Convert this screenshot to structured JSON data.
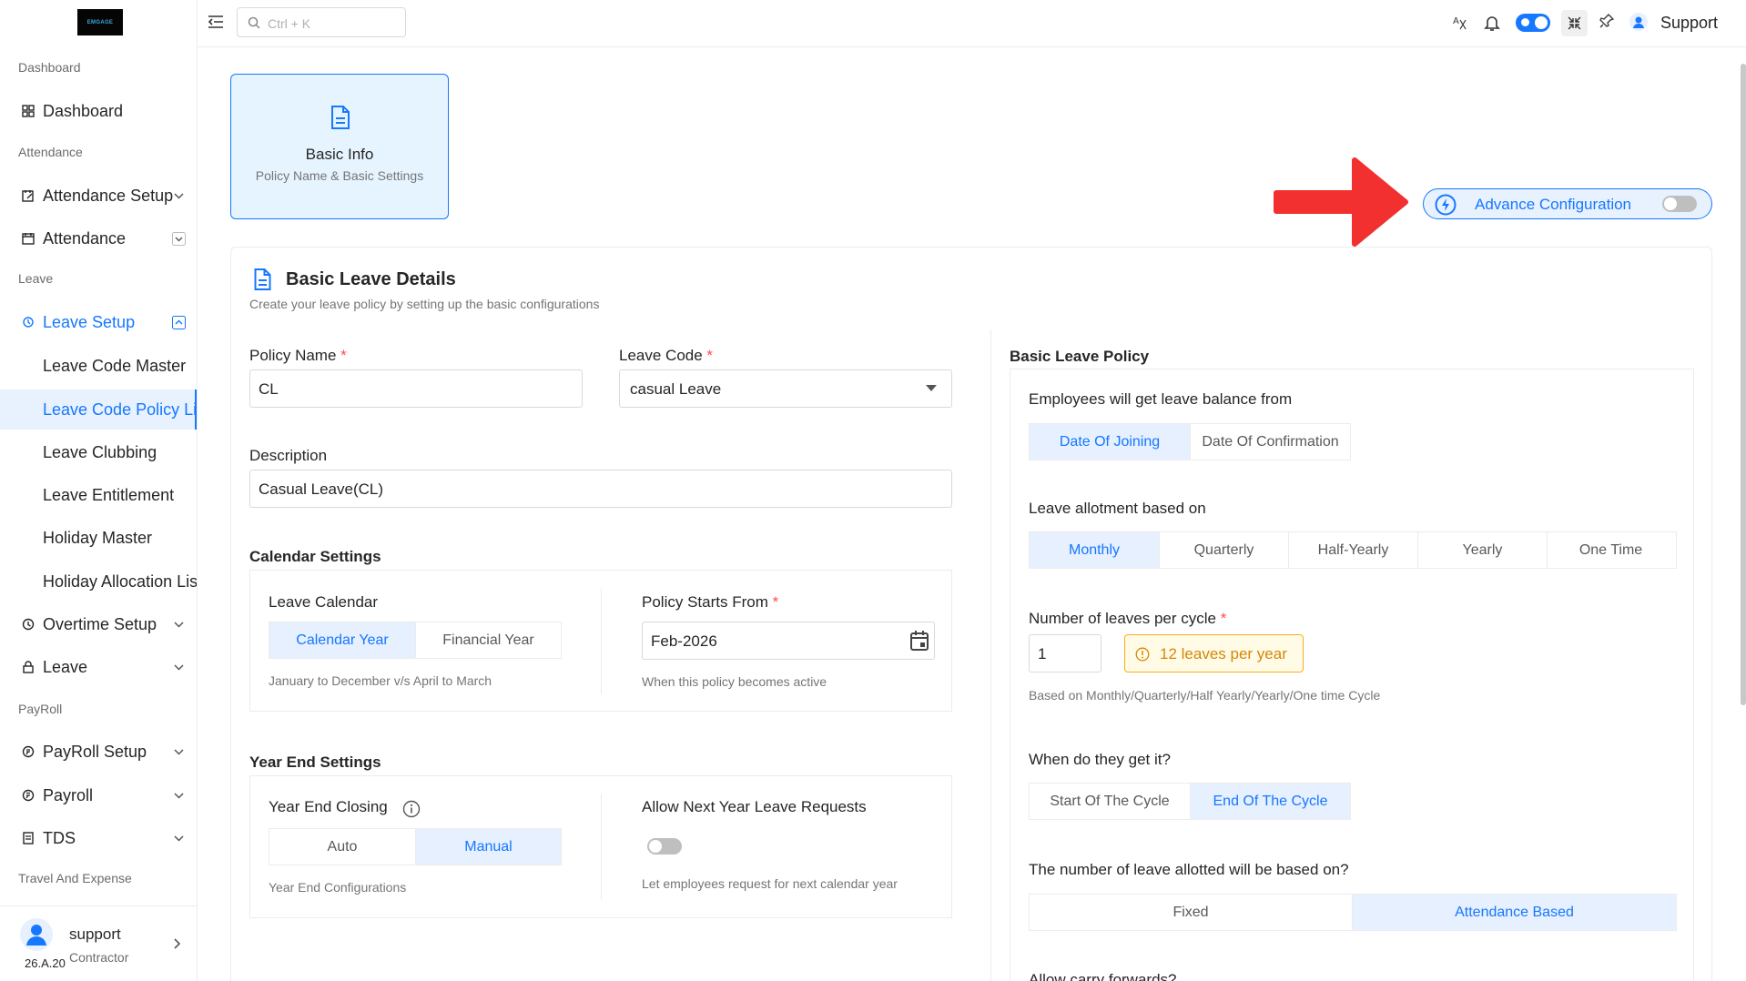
{
  "brand": {
    "logo_text": "EMGAGE"
  },
  "sidebar": {
    "sections": {
      "dashboard": "Dashboard",
      "attendance": "Attendance",
      "leave": "Leave",
      "payroll": "PayRoll",
      "travel": "Travel And Expense"
    },
    "items": {
      "dashboard": "Dashboard",
      "attendance_setup": "Attendance Setup",
      "attendance": "Attendance",
      "leave_setup": "Leave Setup",
      "leave_code_master": "Leave Code Master",
      "leave_code_policy": "Leave Code Policy List",
      "leave_clubbing": "Leave Clubbing",
      "leave_entitlement": "Leave Entitlement",
      "holiday_master": "Holiday Master",
      "holiday_allocation": "Holiday Allocation List",
      "overtime_setup": "Overtime Setup",
      "leave": "Leave",
      "payroll_setup": "PayRoll Setup",
      "payroll": "Payroll",
      "tds": "TDS"
    },
    "footer": {
      "user": "support",
      "role": "Contractor",
      "version": "26.A.20"
    }
  },
  "topbar": {
    "search_placeholder": "Ctrl + K",
    "user": "Support"
  },
  "step": {
    "title": "Basic Info",
    "subtitle": "Policy Name & Basic Settings"
  },
  "advance": {
    "label": "Advance Configuration",
    "enabled": false
  },
  "form": {
    "title": "Basic Leave Details",
    "subtitle": "Create your leave policy by setting up the basic configurations",
    "policy_name_label": "Policy Name",
    "policy_name_value": "CL",
    "leave_code_label": "Leave Code",
    "leave_code_value": "casual Leave",
    "description_label": "Description",
    "description_value": "Casual Leave(CL)",
    "required_mark": "*",
    "calendar": {
      "title": "Calendar Settings",
      "leave_calendar_label": "Leave Calendar",
      "options": [
        "Calendar Year",
        "Financial Year"
      ],
      "selected": "Calendar Year",
      "hint": "January to December v/s April to March",
      "starts_label": "Policy Starts From",
      "starts_value": "Feb-2026",
      "starts_hint": "When this policy becomes active"
    },
    "year_end": {
      "title": "Year End Settings",
      "closing_label": "Year End Closing",
      "options": [
        "Auto",
        "Manual"
      ],
      "selected": "Manual",
      "hint": "Year End Configurations",
      "allow_label": "Allow Next Year Leave Requests",
      "allow_enabled": false,
      "allow_hint": "Let employees request for next calendar year"
    },
    "policy": {
      "title": "Basic Leave Policy",
      "balance_label": "Employees will get leave balance from",
      "balance_options": [
        "Date Of Joining",
        "Date Of Confirmation"
      ],
      "balance_selected": "Date Of Joining",
      "allotment_label": "Leave allotment based on",
      "allotment_options": [
        "Monthly",
        "Quarterly",
        "Half-Yearly",
        "Yearly",
        "One Time"
      ],
      "allotment_selected": "Monthly",
      "per_cycle_label": "Number of leaves per cycle",
      "per_cycle_value": "1",
      "per_year_badge": "12 leaves per year",
      "per_cycle_hint": "Based on Monthly/Quarterly/Half Yearly/Yearly/One time Cycle",
      "when_label": "When do they get it?",
      "when_options": [
        "Start Of The Cycle",
        "End Of The Cycle"
      ],
      "when_selected": "End Of The Cycle",
      "basis_label": "The number of leave allotted will be based on?",
      "basis_options": [
        "Fixed",
        "Attendance Based"
      ],
      "basis_selected": "Attendance Based",
      "carry_label": "Allow carry forwards?"
    }
  },
  "colors": {
    "accent": "#1677ff",
    "selected_bg": "#e6f0ff",
    "annotation_arrow": "#f23030",
    "badge": "#faad14"
  }
}
